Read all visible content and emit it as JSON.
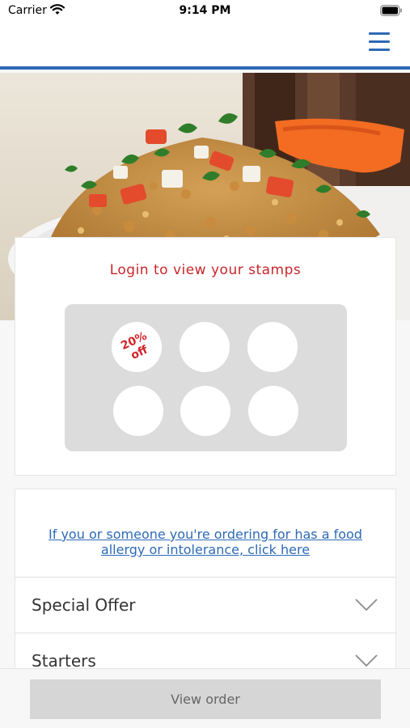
{
  "status_bar": {
    "carrier": "Carrier",
    "time": "9:14 PM",
    "wifi_icon": "wifi-icon",
    "battery_icon": "battery-icon"
  },
  "nav": {
    "menu_icon": "hamburger-menu-icon",
    "accent_color": "#2d6ab5"
  },
  "hero": {
    "image": "food-photo"
  },
  "stamps": {
    "title": "Login to view your stamps",
    "title_color": "#c8262a",
    "reward_label": "20% off",
    "reward_line1": "20%",
    "reward_line2": "off",
    "total": 6
  },
  "allergy": {
    "link_text": "If you or someone you're ordering for has a food allergy or intolerance, click here"
  },
  "menu": {
    "sections": [
      {
        "label": "Special Offer"
      },
      {
        "label": "Starters"
      }
    ]
  },
  "order": {
    "button_label": "View order"
  }
}
